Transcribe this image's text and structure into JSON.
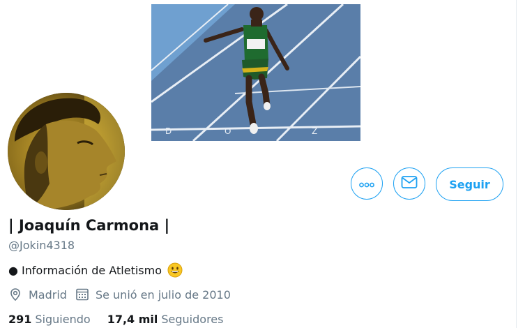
{
  "profile": {
    "display_name": "| Joaquín Carmona |",
    "handle": "@Jokin4318",
    "bio_text": "● Información de Atletismo",
    "location": "Madrid",
    "joined": "Se unió en julio de 2010",
    "following_count": "291",
    "following_label": "Siguiendo",
    "followers_count": "17,4 mil",
    "followers_label": "Seguidores"
  },
  "actions": {
    "follow_label": "Seguir"
  },
  "icons": {
    "more": "more-options-icon",
    "message": "envelope-icon",
    "location": "location-pin-icon",
    "calendar": "calendar-icon",
    "emoji": "grinning-face-emoji"
  },
  "colors": {
    "accent": "#1da1f2",
    "secondary_text": "#657786",
    "primary_text": "#14171a"
  }
}
